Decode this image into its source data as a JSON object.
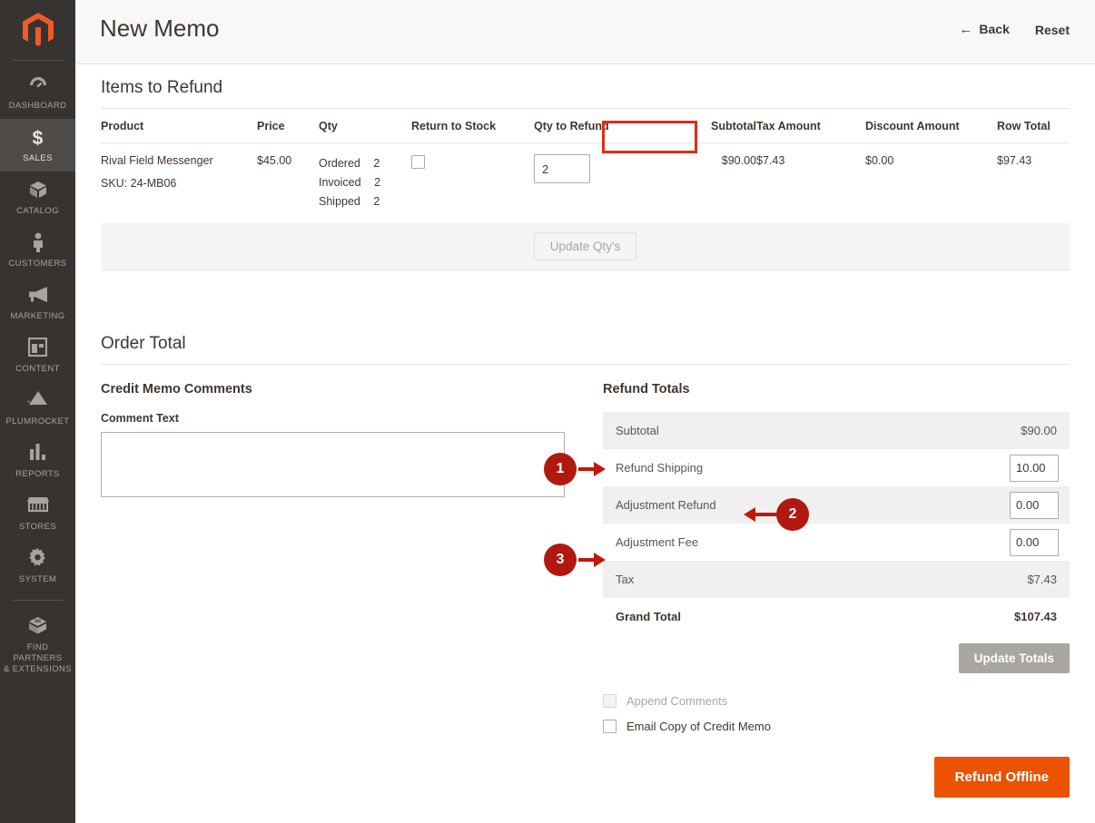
{
  "sidebar": {
    "logo": {
      "name": "magento-logo",
      "color": "#f05a28"
    },
    "items": [
      {
        "id": "dashboard",
        "icon": "gauge-icon",
        "glyph": "◔",
        "label": "DASHBOARD",
        "active": false
      },
      {
        "id": "sales",
        "icon": "dollar-icon",
        "glyph": "$",
        "label": "SALES",
        "active": true
      },
      {
        "id": "catalog",
        "icon": "box-icon",
        "glyph": "◈",
        "label": "CATALOG",
        "active": false
      },
      {
        "id": "customers",
        "icon": "person-icon",
        "glyph": "🯅",
        "label": "CUSTOMERS",
        "active": false
      },
      {
        "id": "marketing",
        "icon": "megaphone-icon",
        "glyph": "◀",
        "label": "MARKETING",
        "active": false
      },
      {
        "id": "content",
        "icon": "layout-icon",
        "glyph": "▤",
        "label": "CONTENT",
        "active": false
      },
      {
        "id": "plumrocket",
        "icon": "plumrocket-icon",
        "glyph": "▲",
        "label": "PLUMROCKET",
        "active": false
      },
      {
        "id": "reports",
        "icon": "bar-chart-icon",
        "glyph": "▮",
        "label": "REPORTS",
        "active": false
      },
      {
        "id": "stores",
        "icon": "storefront-icon",
        "glyph": "🏪",
        "label": "STORES",
        "active": false
      },
      {
        "id": "system",
        "icon": "gear-icon",
        "glyph": "✿",
        "label": "SYSTEM",
        "active": false
      },
      {
        "id": "partners",
        "icon": "extension-icon",
        "glyph": "◈",
        "label": "FIND PARTNERS\n& EXTENSIONS",
        "active": false
      }
    ],
    "partners_label_line1": "FIND PARTNERS",
    "partners_label_line2": "& EXTENSIONS"
  },
  "header": {
    "title": "New Memo",
    "back_label": "Back",
    "back_icon": "arrow-left-icon",
    "back_glyph": "←",
    "reset_label": "Reset"
  },
  "items_section": {
    "heading": "Items to Refund",
    "columns": [
      "Product",
      "Price",
      "Qty",
      "Return to Stock",
      "Qty to Refund",
      "Subtotal",
      "Tax Amount",
      "Discount Amount",
      "Row Total"
    ],
    "highlighted_column": "Qty to Refund",
    "highlight_color": "#e02b18",
    "row": {
      "product_name": "Rival Field Messenger",
      "sku": "SKU: 24-MB06",
      "price": "$45.00",
      "qty_ordered_label": "Ordered",
      "qty_ordered_value": "2",
      "qty_invoiced_label": "Invoiced",
      "qty_invoiced_value": "2",
      "qty_shipped_label": "Shipped",
      "qty_shipped_value": "2",
      "return_to_stock_checked": false,
      "qty_to_refund": "2",
      "subtotal": "$90.00",
      "tax_amount": "$7.43",
      "discount_amount": "$0.00",
      "row_total": "$97.43"
    },
    "update_qty_button": "Update Qty's"
  },
  "order_total": {
    "heading": "Order Total",
    "comments": {
      "heading": "Credit Memo Comments",
      "field_label": "Comment Text",
      "value": "",
      "placeholder": ""
    },
    "refund_totals": {
      "heading": "Refund Totals",
      "rows": [
        {
          "label": "Subtotal",
          "value": "$90.00",
          "input": false,
          "striped": true
        },
        {
          "label": "Refund Shipping",
          "value": "10.00",
          "input": true,
          "striped": false
        },
        {
          "label": "Adjustment Refund",
          "value": "0.00",
          "input": true,
          "striped": true
        },
        {
          "label": "Adjustment Fee",
          "value": "0.00",
          "input": true,
          "striped": false
        },
        {
          "label": "Tax",
          "value": "$7.43",
          "input": false,
          "striped": true
        }
      ],
      "grand_total_label": "Grand Total",
      "grand_total_value": "$107.43",
      "update_totals_button": "Update Totals"
    },
    "options": [
      {
        "id": "append-comments",
        "label": "Append Comments",
        "checked": false,
        "disabled": true
      },
      {
        "id": "email-copy",
        "label": "Email Copy of Credit Memo",
        "checked": false,
        "disabled": false
      }
    ],
    "submit_button": "Refund Offline"
  },
  "callouts": [
    {
      "number": "1",
      "direction": "right",
      "target": "Refund Shipping"
    },
    {
      "number": "2",
      "direction": "left",
      "target": "Adjustment Refund"
    },
    {
      "number": "3",
      "direction": "right",
      "target": "Adjustment Fee"
    }
  ],
  "callout_color": "#b01810"
}
